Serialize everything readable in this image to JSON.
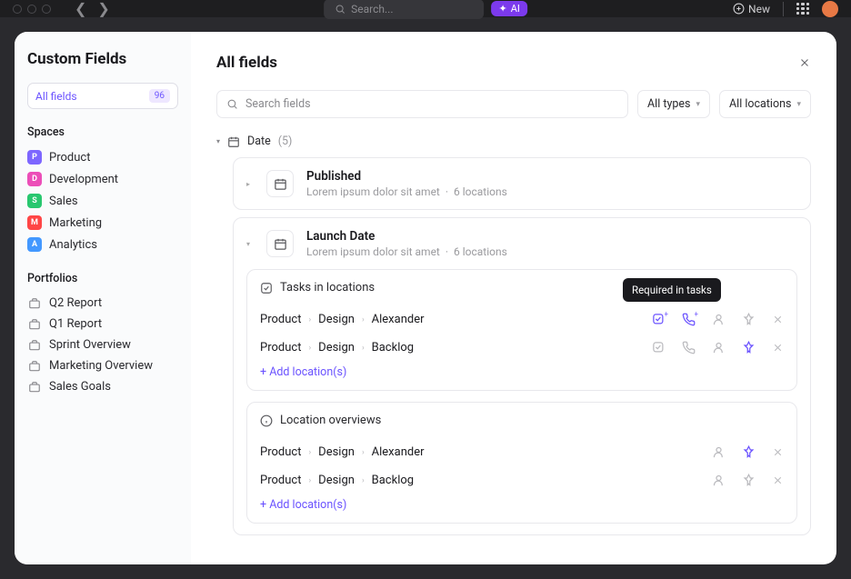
{
  "titlebar": {
    "search_placeholder": "Search...",
    "ai_label": "AI",
    "new_label": "New"
  },
  "sidebar": {
    "title": "Custom Fields",
    "all_fields": {
      "label": "All fields",
      "count": "96"
    },
    "spaces_label": "Spaces",
    "spaces": [
      {
        "letter": "P",
        "color": "#7d66ff",
        "label": "Product"
      },
      {
        "letter": "D",
        "color": "#ec4eb8",
        "label": "Development"
      },
      {
        "letter": "S",
        "color": "#28c76f",
        "label": "Sales"
      },
      {
        "letter": "M",
        "color": "#ff4646",
        "label": "Marketing"
      },
      {
        "letter": "A",
        "color": "#4398ff",
        "label": "Analytics"
      }
    ],
    "portfolios_label": "Portfolios",
    "portfolios": [
      "Q2 Report",
      "Q1 Report",
      "Sprint Overview",
      "Marketing Overview",
      "Sales Goals"
    ]
  },
  "main": {
    "title": "All fields",
    "search_placeholder": "Search fields",
    "dropdown_types": "All types",
    "dropdown_locations": "All locations",
    "group_label": "Date",
    "group_count": "(5)",
    "cards": [
      {
        "title": "Published",
        "desc": "Lorem ipsum dolor sit amet",
        "loc": "6 locations"
      },
      {
        "title": "Launch Date",
        "desc": "Lorem ipsum dolor sit amet",
        "loc": "6 locations"
      }
    ],
    "panel_tasks": "Tasks in locations",
    "tooltip": "Required in tasks",
    "panel_locations": "Location overviews",
    "rows": [
      [
        "Product",
        "Design",
        "Alexander"
      ],
      [
        "Product",
        "Design",
        "Backlog"
      ]
    ],
    "add_label": "+ Add location(s)"
  },
  "icons": {
    "calendar_color": "#5a5a5e"
  }
}
